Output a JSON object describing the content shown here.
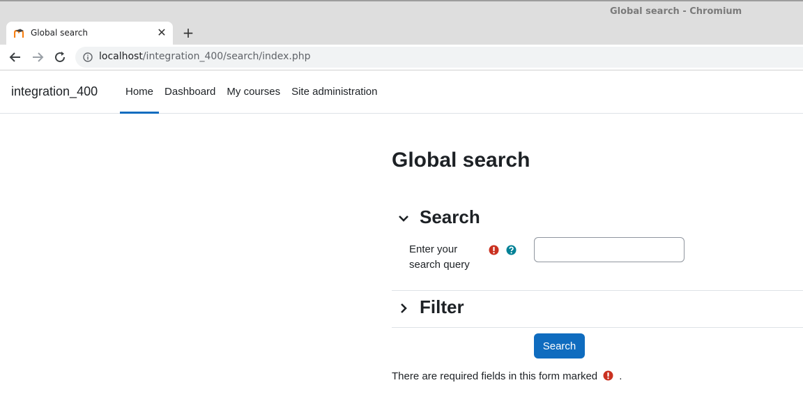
{
  "browser": {
    "window_title": "Global search - Chromium",
    "tab": {
      "title": "Global search",
      "favicon": "moodle-icon"
    },
    "url_host": "localhost",
    "url_path": "/integration_400/search/index.php"
  },
  "navbar": {
    "brand": "integration_400",
    "links": [
      {
        "label": "Home",
        "active": true
      },
      {
        "label": "Dashboard"
      },
      {
        "label": "My courses"
      },
      {
        "label": "Site administration"
      }
    ]
  },
  "page": {
    "title": "Global search",
    "sections": {
      "search": {
        "title": "Search",
        "expanded": true
      },
      "filter": {
        "title": "Filter",
        "expanded": false
      }
    },
    "query_field": {
      "label": "Enter your search query",
      "value": "",
      "placeholder": ""
    },
    "submit_label": "Search",
    "required_note": "There are required fields in this form marked",
    "required_note_end": "."
  },
  "colors": {
    "accent": "#0f6cbf",
    "required": "#ca3120",
    "help": "#008196"
  }
}
